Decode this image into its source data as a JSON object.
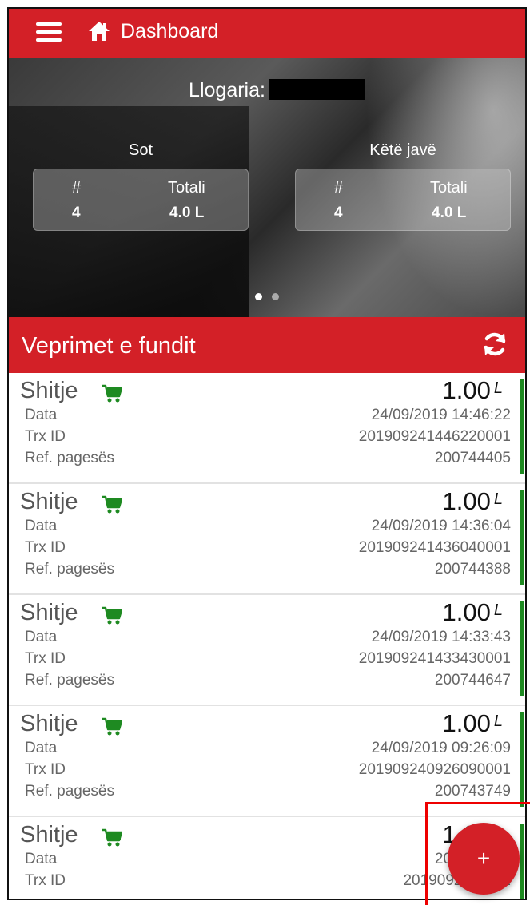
{
  "header": {
    "title": "Dashboard",
    "menu_icon": "hamburger-menu-icon",
    "home_icon": "home-icon"
  },
  "hero": {
    "account_label": "Llogaria:",
    "today": {
      "period": "Sot",
      "count_label": "#",
      "total_label": "Totali",
      "count": "4",
      "total": "4.0 L"
    },
    "week": {
      "period": "Këtë javë",
      "count_label": "#",
      "total_label": "Totali",
      "count": "4",
      "total": "4.0 L"
    },
    "pages": 2,
    "active_page": 1
  },
  "section": {
    "title": "Veprimet e fundit",
    "refresh_icon": "refresh-icon"
  },
  "labels": {
    "date": "Data",
    "trx": "Trx ID",
    "ref": "Ref. pagesës"
  },
  "transactions": [
    {
      "type": "Shitje",
      "amount": "1.00",
      "unit": "L",
      "date": "24/09/2019 14:46:22",
      "trx_id": "201909241446220001",
      "ref": "200744405"
    },
    {
      "type": "Shitje",
      "amount": "1.00",
      "unit": "L",
      "date": "24/09/2019 14:36:04",
      "trx_id": "201909241436040001",
      "ref": "200744388"
    },
    {
      "type": "Shitje",
      "amount": "1.00",
      "unit": "L",
      "date": "24/09/2019 14:33:43",
      "trx_id": "201909241433430001",
      "ref": "200744647"
    },
    {
      "type": "Shitje",
      "amount": "1.00",
      "unit": "L",
      "date": "24/09/2019 09:26:09",
      "trx_id": "201909240926090001",
      "ref": "200743749"
    },
    {
      "type": "Shitje",
      "amount": "1.00",
      "unit": "L",
      "date": "20/09/2019",
      "trx_id": "2019092011171",
      "ref": ""
    }
  ],
  "fab": {
    "label": "+"
  },
  "colors": {
    "brand_red": "#d32027",
    "status_green": "#1e8a21"
  }
}
